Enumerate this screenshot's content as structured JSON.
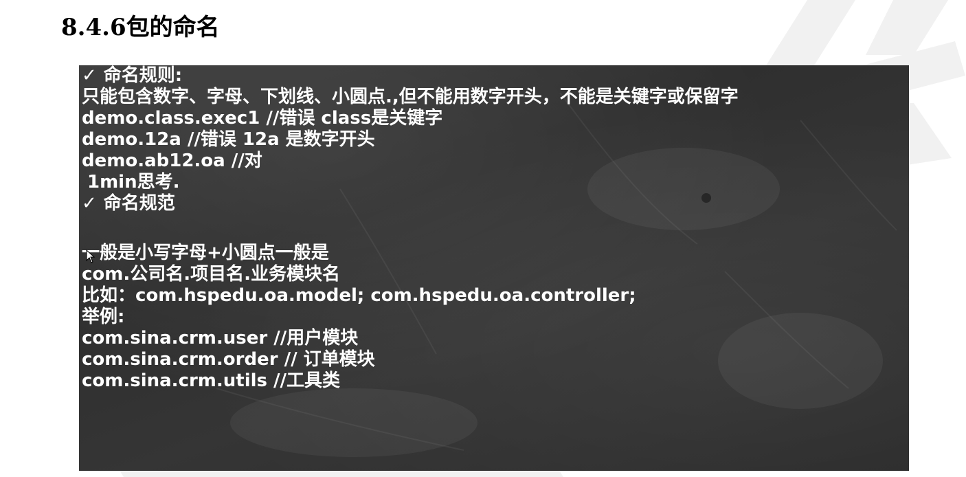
{
  "title": "8.4.6包的命名",
  "slide": {
    "check_icon": "checkmark-icon",
    "lines": {
      "rules_heading": "命名规则:",
      "rule_desc": "只能包含数字、字母、下划线、小圆点.,但不能用数字开头，不能是关键字或保留字",
      "example1": "demo.class.exec1  //错误 class是关键字",
      "example2": "demo.12a  //错误  12a 是数字开头",
      "example3": "demo.ab12.oa //对",
      "think": "1min思考.",
      "conventions_heading": "命名规范",
      "conv_desc": "一般是小写字母+小圆点一般是",
      "conv_pattern": "com.公司名.项目名.业务模块名",
      "for_example": "比如：com.hspedu.oa.model;  com.hspedu.oa.controller;",
      "examples_label": "举例:",
      "ex_user": "com.sina.crm.user //用户模块",
      "ex_order": "com.sina.crm.order // 订单模块",
      "ex_utils": "com.sina.crm.utils //工具类"
    }
  },
  "colors": {
    "page_bg": "#ffffff",
    "slide_bg": "#333333",
    "slide_text": "#ffffff",
    "watermark": "#f2f2f2"
  }
}
